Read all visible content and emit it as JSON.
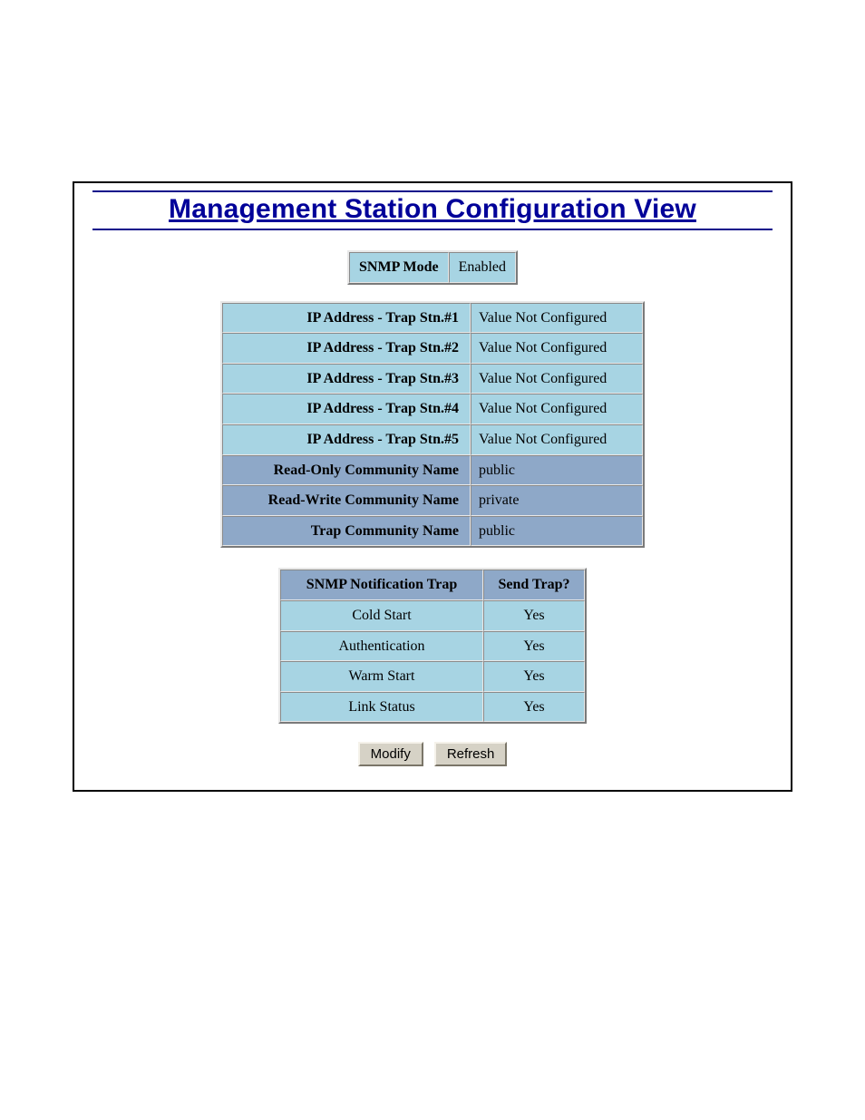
{
  "title": "Management Station Configuration View",
  "mode": {
    "label": "SNMP Mode",
    "value": "Enabled"
  },
  "config_rows": [
    {
      "label": "IP Address - Trap Stn.#1",
      "value": "Value Not Configured",
      "alt": false
    },
    {
      "label": "IP Address - Trap Stn.#2",
      "value": "Value Not Configured",
      "alt": false
    },
    {
      "label": "IP Address - Trap Stn.#3",
      "value": "Value Not Configured",
      "alt": false
    },
    {
      "label": "IP Address - Trap Stn.#4",
      "value": "Value Not Configured",
      "alt": false
    },
    {
      "label": "IP Address - Trap Stn.#5",
      "value": "Value Not Configured",
      "alt": false
    },
    {
      "label": "Read-Only Community Name",
      "value": "public",
      "alt": true
    },
    {
      "label": "Read-Write Community Name",
      "value": "private",
      "alt": true
    },
    {
      "label": "Trap Community Name",
      "value": "public",
      "alt": true
    }
  ],
  "trap_table": {
    "col1": "SNMP Notification Trap",
    "col2": "Send Trap?",
    "rows": [
      {
        "name": "Cold Start",
        "send": "Yes"
      },
      {
        "name": "Authentication",
        "send": "Yes"
      },
      {
        "name": "Warm Start",
        "send": "Yes"
      },
      {
        "name": "Link Status",
        "send": "Yes"
      }
    ]
  },
  "buttons": {
    "modify": "Modify",
    "refresh": "Refresh"
  }
}
